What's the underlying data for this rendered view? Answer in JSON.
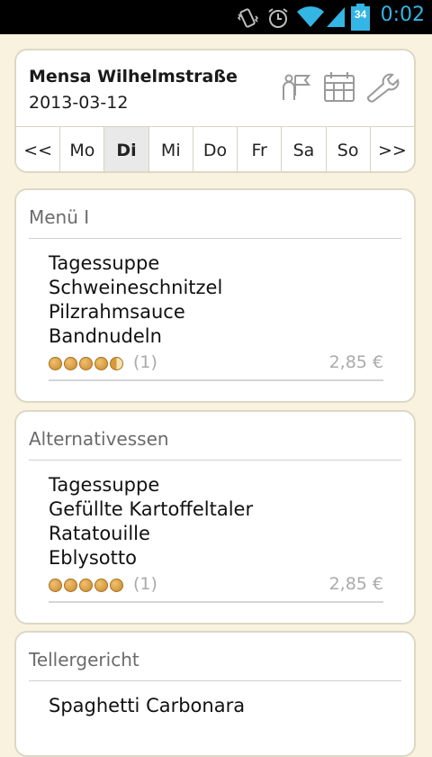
{
  "status_bar": {
    "battery_level": "34",
    "time": "0:02",
    "icons": [
      "vibrate-icon",
      "alarm-icon",
      "wifi-icon",
      "signal-icon",
      "battery-icon"
    ]
  },
  "header": {
    "mensa_name": "Mensa Wilhelmstraße",
    "date": "2013-03-12",
    "actions": [
      "location-flag-icon",
      "calendar-icon",
      "settings-wrench-icon"
    ]
  },
  "day_nav": {
    "items": [
      "<<",
      "Mo",
      "Di",
      "Mi",
      "Do",
      "Fr",
      "Sa",
      "So",
      ">>"
    ],
    "active": "Di"
  },
  "meals": [
    {
      "title": "Menü I",
      "dishes": [
        "Tagessuppe",
        "Schweineschnitzel",
        "Pilzrahmsauce",
        "Bandnudeln"
      ],
      "rating_stars": 4.5,
      "rating_count": "(1)",
      "price": "2,85 €"
    },
    {
      "title": "Alternativessen",
      "dishes": [
        "Tagessuppe",
        "Gefüllte Kartoffeltaler",
        "Ratatouille",
        "Eblysotto"
      ],
      "rating_stars": 5,
      "rating_count": "(1)",
      "price": "2,85 €"
    },
    {
      "title": "Tellergericht",
      "dishes": [
        "Spaghetti Carbonara"
      ]
    }
  ],
  "colors": {
    "background": "#f8f2df",
    "accent": "#33b5e5",
    "card_border": "#ddd7c5",
    "muted_text": "#aaaaaa"
  }
}
